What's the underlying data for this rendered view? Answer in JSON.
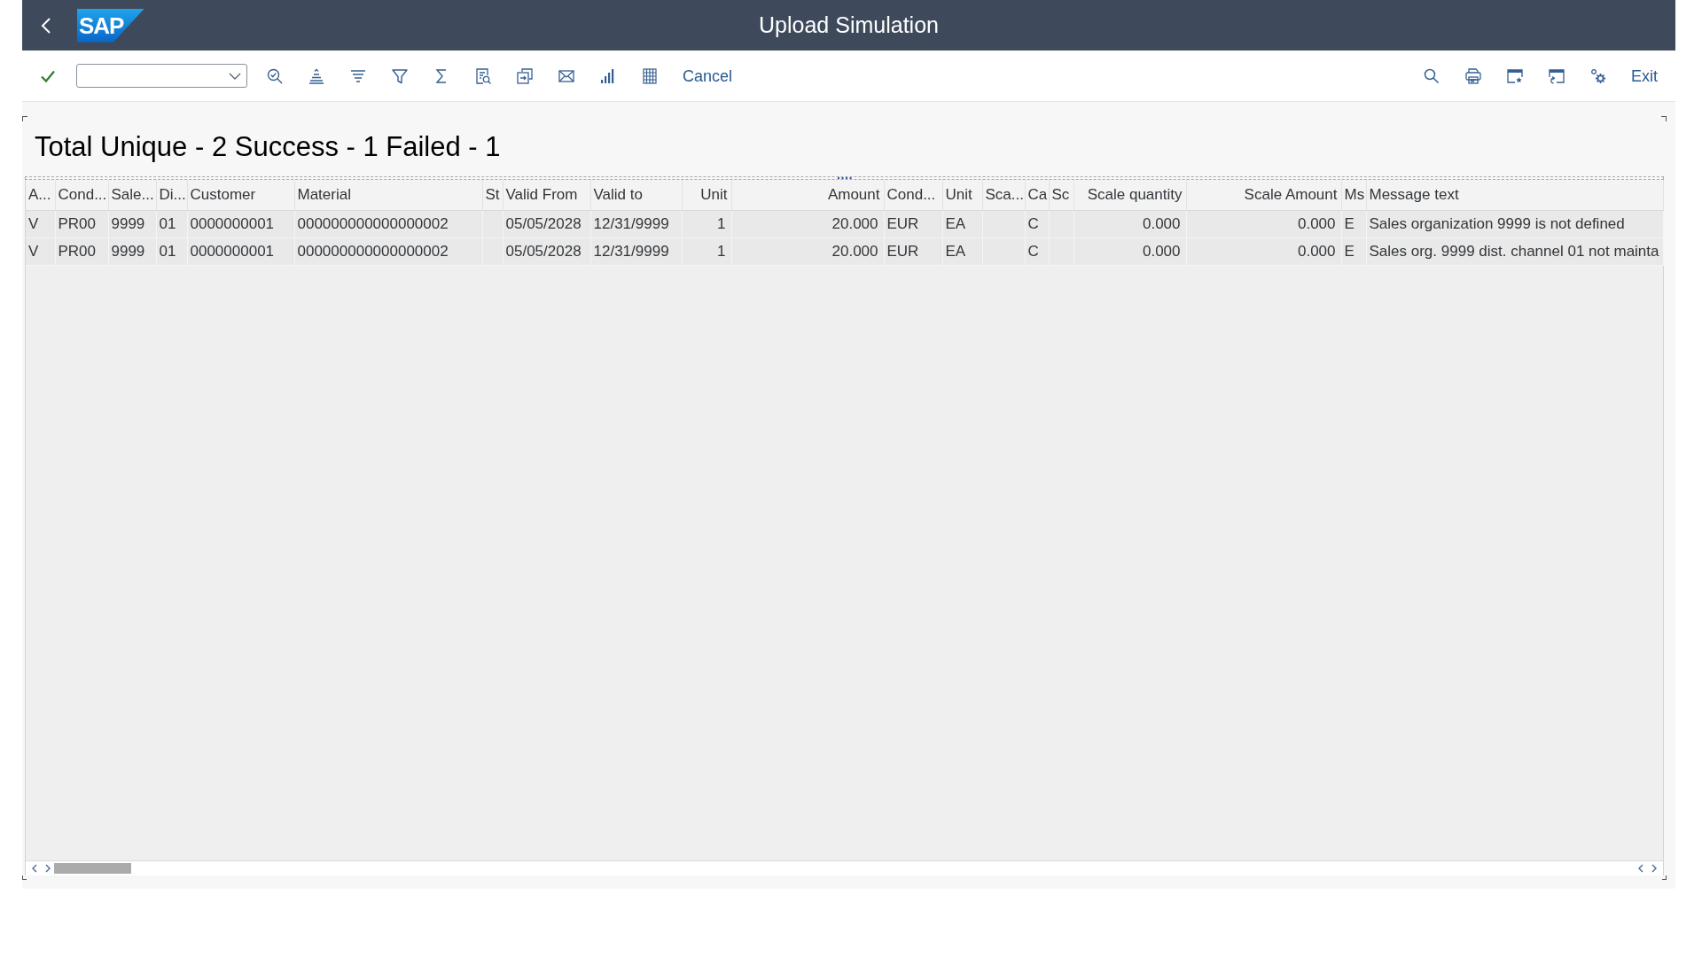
{
  "header": {
    "logo_text": "SAP",
    "title": "Upload Simulation"
  },
  "toolbar": {
    "cancel_label": "Cancel",
    "exit_label": "Exit"
  },
  "report": {
    "title": "Total Unique - 2 Success - 1 Failed - 1",
    "table": {
      "columns": [
        "A...",
        "Cond...",
        "Sale...",
        "Di...",
        "Customer",
        "Material",
        "St",
        "Valid From",
        "Valid to",
        "Unit",
        "Amount",
        "Cond...",
        "Unit",
        "Sca...",
        "Ca",
        "Sc",
        "Scale quantity",
        "Scale Amount",
        "Ms",
        "Message text"
      ],
      "rows": [
        [
          "V",
          "PR00",
          "9999",
          "01",
          "0000000001",
          "000000000000000002",
          null,
          "05/05/2028",
          "12/31/9999",
          "1",
          "20.000",
          "EUR",
          "EA",
          null,
          "C",
          null,
          "0.000",
          "0.000",
          "E",
          "Sales organization 9999 is not defined"
        ],
        [
          "V",
          "PR00",
          "9999",
          "01",
          "0000000001",
          "000000000000000002",
          null,
          "05/05/2028",
          "12/31/9999",
          "1",
          "20.000",
          "EUR",
          "EA",
          null,
          "C",
          null,
          "0.000",
          "0.000",
          "E",
          "Sales org. 9999 dist. channel 01 not mainta"
        ]
      ]
    }
  }
}
